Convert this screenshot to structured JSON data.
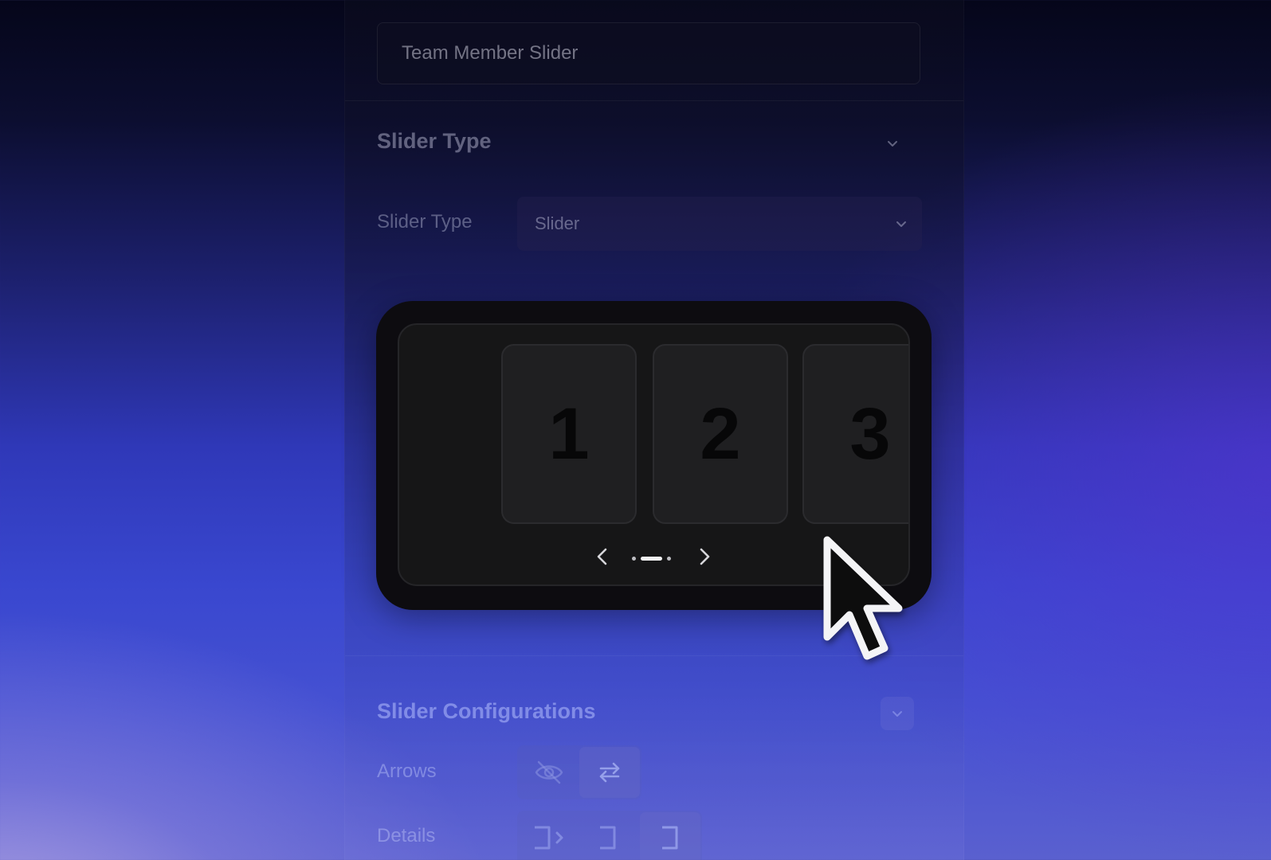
{
  "slider_name": {
    "value": "Team Member Slider"
  },
  "slider_type_section": {
    "title": "Slider Type",
    "field_label": "Slider Type",
    "selected": "Slider"
  },
  "preview": {
    "slides": [
      "1",
      "2",
      "3"
    ],
    "active_dot": 1,
    "dot_count": 3
  },
  "config_section": {
    "title": "Slider Configurations",
    "arrows_label": "Arrows",
    "details_label": "Details"
  },
  "icons": {
    "section_chevron": "chevron-down-icon",
    "prev": "chevron-left-icon",
    "next": "chevron-right-icon",
    "arrows_hidden": "eye-off-icon",
    "arrows_visible": "arrows-swap-icon",
    "cursor": "mouse-pointer-icon"
  }
}
